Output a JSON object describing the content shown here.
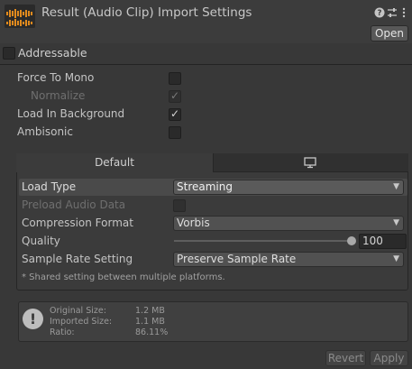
{
  "header": {
    "title": "Result (Audio Clip) Import Settings",
    "open_label": "Open",
    "help_icon": "help-icon",
    "settings_icon": "sliders-icon",
    "menu_icon": "kebab-icon"
  },
  "addressable": {
    "label": "Addressable",
    "checked": false
  },
  "general": {
    "force_to_mono": {
      "label": "Force To Mono",
      "checked": false
    },
    "normalize": {
      "label": "Normalize",
      "checked": true,
      "disabled": true
    },
    "load_in_background": {
      "label": "Load In Background",
      "checked": true
    },
    "ambisonic": {
      "label": "Ambisonic",
      "checked": false
    }
  },
  "tabs": {
    "default_label": "Default",
    "platform_icon": "monitor-icon"
  },
  "platform_settings": {
    "load_type": {
      "label": "Load Type",
      "value": "Streaming"
    },
    "preload_audio_data": {
      "label": "Preload Audio Data",
      "checked": false,
      "disabled": true
    },
    "compression_format": {
      "label": "Compression Format",
      "value": "Vorbis"
    },
    "quality": {
      "label": "Quality",
      "value": "100",
      "level": 1.0
    },
    "sample_rate_setting": {
      "label": "Sample Rate Setting",
      "value": "Preserve Sample Rate"
    },
    "note": "* Shared setting between multiple platforms."
  },
  "info": {
    "icon": "exclamation-icon",
    "original_size_label": "Original Size:",
    "original_size": "1.2 MB",
    "imported_size_label": "Imported Size:",
    "imported_size": "1.1 MB",
    "ratio_label": "Ratio:",
    "ratio": "86.11%"
  },
  "footer": {
    "revert_label": "Revert",
    "apply_label": "Apply"
  },
  "colors": {
    "background": "#383838",
    "waveform": "#e08a1e",
    "text": "#c4c4c4"
  }
}
